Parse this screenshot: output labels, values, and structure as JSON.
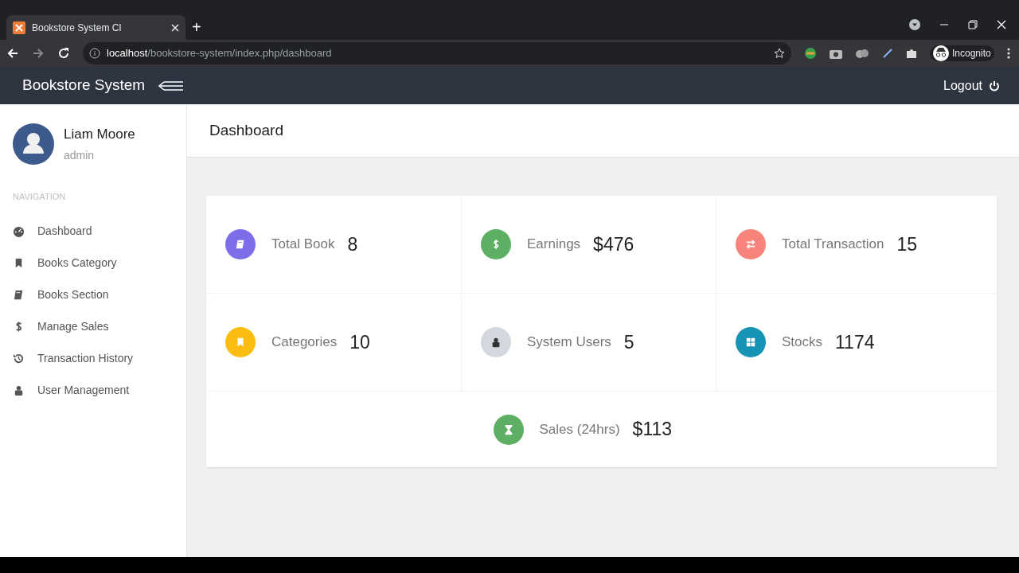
{
  "browser": {
    "tab_title": "Bookstore System CI",
    "new_tab": "+",
    "address": "**localhost**/bookstore-system/index.php/dashboard",
    "profile": "Incognito"
  },
  "navbar": {
    "brand": "Bookstore System",
    "logout": "Logout"
  },
  "user": {
    "name": "Liam Moore",
    "role": "admin"
  },
  "sidebar": {
    "heading": "NAVIGATION",
    "items": [
      {
        "label": "Dashboard",
        "kind": "gauge"
      },
      {
        "label": "Books Category",
        "kind": "bookmark"
      },
      {
        "label": "Books Section",
        "kind": "book"
      },
      {
        "label": "Manage Sales",
        "kind": "dollar"
      },
      {
        "label": "Transaction History",
        "kind": "history"
      },
      {
        "label": "User Management",
        "kind": "user"
      }
    ]
  },
  "page_title": "Dashboard",
  "stats": [
    [
      {
        "label": "Total Book",
        "value": "8",
        "kind": "book",
        "color": "#7b6ee8"
      },
      {
        "label": "Earnings",
        "value": "$476",
        "kind": "dollar",
        "color": "#5daf64"
      },
      {
        "label": "Total Transaction",
        "value": "15",
        "kind": "exchange",
        "color": "#f8837a"
      }
    ],
    [
      {
        "label": "Categories",
        "value": "10",
        "kind": "bookmark",
        "color": "#fbbd12"
      },
      {
        "label": "System Users",
        "value": "5",
        "kind": "user",
        "color": "#d3d8df"
      },
      {
        "label": "Stocks",
        "value": "1174",
        "kind": "grid",
        "color": "#1793b6"
      }
    ],
    [
      {
        "label": "Sales (24hrs)",
        "value": "$113",
        "kind": "hourglass",
        "color": "#5daf64"
      }
    ]
  ]
}
